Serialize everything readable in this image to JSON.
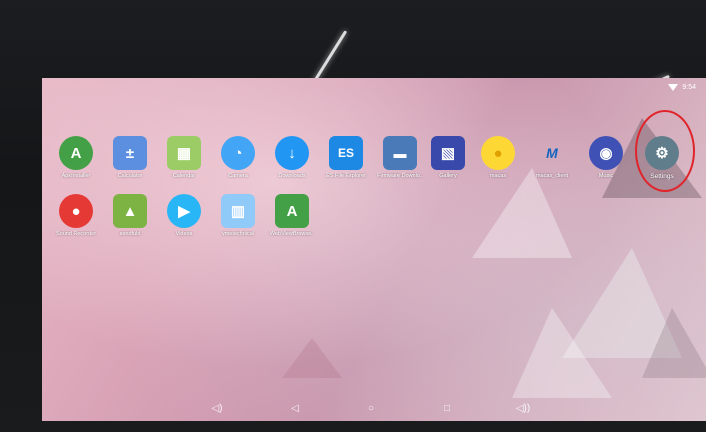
{
  "status_bar": {
    "time": "9:54",
    "wifi_icon": "wifi-icon"
  },
  "apps": [
    {
      "label": "ApkInstaller",
      "icon": "android-icon",
      "color": "#43a047",
      "glyph": "⚙"
    },
    {
      "label": "Calculator",
      "icon": "calculator-icon",
      "color": "#5c8fe0",
      "glyph": "±"
    },
    {
      "label": "Calendar",
      "icon": "calendar-icon",
      "color": "#9ccc65",
      "glyph": "▦"
    },
    {
      "label": "Camera",
      "icon": "camera-icon",
      "color": "#42a5f5",
      "glyph": "◔"
    },
    {
      "label": "Downloads",
      "icon": "download-icon",
      "color": "#2196f3",
      "glyph": "↓"
    },
    {
      "label": "ES File Explorer",
      "icon": "folder-icon",
      "color": "#1e88e5",
      "glyph": "ES"
    },
    {
      "label": "Firmware Downlo..",
      "icon": "connector-icon",
      "color": "#4a7ab8",
      "glyph": "▬"
    },
    {
      "label": "Gallery",
      "icon": "gallery-icon",
      "color": "#3949ab",
      "glyph": "▧"
    },
    {
      "label": "macas",
      "icon": "duck-icon",
      "color": "#fdd835",
      "glyph": "●"
    },
    {
      "label": "macas_client",
      "icon": "macas-logo-icon",
      "color": "#1565c0",
      "glyph": "M"
    },
    {
      "label": "Music",
      "icon": "music-icon",
      "color": "#3f51b5",
      "glyph": "◉"
    },
    {
      "label": "Settings",
      "icon": "gear-icon",
      "color": "#607d8b",
      "glyph": "⚙"
    },
    {
      "label": "Sound Recorder",
      "icon": "microphone-icon",
      "color": "#e53935",
      "glyph": "●"
    },
    {
      "label": "sendfuld",
      "icon": "android-icon",
      "color": "#7cb342",
      "glyph": "▲"
    },
    {
      "label": "Videos",
      "icon": "play-icon",
      "color": "#29b6f6",
      "glyph": "▶"
    },
    {
      "label": "vmetechnical",
      "icon": "window-icon",
      "color": "#90caf9",
      "glyph": "▥"
    },
    {
      "label": "WebViewBrowse..",
      "icon": "android-icon",
      "color": "#43a047",
      "glyph": "⚙"
    }
  ],
  "navigation": {
    "volume_down": "volume-down-icon",
    "back": "back-icon",
    "home": "home-icon",
    "recents": "recents-icon",
    "volume_up": "volume-up-icon"
  },
  "highlight_color": "#e0242b"
}
